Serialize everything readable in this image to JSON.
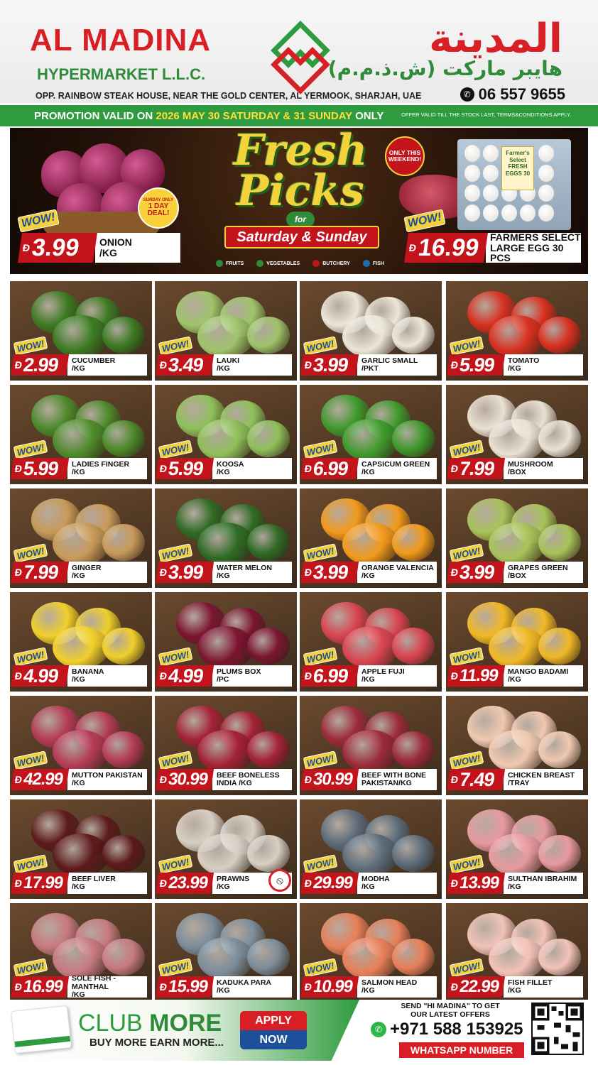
{
  "header": {
    "brand_en": "AL MADINA",
    "brand_sub": "HYPERMARKET L.L.C.",
    "brand_ar": "المدينة",
    "brand_ar_sub": "هايبر ماركت (ش.ذ.م.م)",
    "address": "OPP. RAINBOW STEAK HOUSE, NEAR THE GOLD CENTER, AL YERMOOK, SHARJAH, UAE",
    "phone": "06 557 9655"
  },
  "promo": {
    "prefix": "PROMOTION VALID ON ",
    "dates": "2026 MAY 30 SATURDAY & 31 SUNDAY",
    "suffix": " ONLY",
    "note": "OFFER VALID TILL THE STOCK LAST, TERMS&CONDITIONS APPLY."
  },
  "hero": {
    "title_line1": "Fresh",
    "title_line2": "Picks",
    "for_label": "for",
    "ribbon": "Saturday & Sunday",
    "only_badge": "ONLY THIS WEEKEND!",
    "deal_badge_top": "SUNDAY ONLY",
    "deal_badge_main": "1 DAY DEAL!",
    "egg_label": "Farmer's Select FRESH EGGS 30",
    "categories": [
      "FRUITS",
      "VEGETABLES",
      "BUTCHERY",
      "FISH"
    ],
    "deals": [
      {
        "wow": "WOW!",
        "currency": "Đ",
        "price": "3.99",
        "name": "ONION",
        "unit": "/KG"
      },
      {
        "wow": "WOW!",
        "currency": "Đ",
        "price": "16.99",
        "name": "FARMERS SELECT",
        "unit": "LARGE EGG 30 PCS"
      }
    ]
  },
  "products": [
    {
      "wow": "WOW!",
      "price": "2.99",
      "name": "CUCUMBER",
      "unit": "/KG",
      "color": "#3c7a22"
    },
    {
      "wow": "WOW!",
      "price": "3.49",
      "name": "LAUKI",
      "unit": "/KG",
      "color": "#9fc46a"
    },
    {
      "wow": "WOW!",
      "price": "3.99",
      "name": "GARLIC SMALL",
      "unit": "/PKT",
      "color": "#ece6d8"
    },
    {
      "wow": "WOW!",
      "price": "5.99",
      "name": "TOMATO",
      "unit": "/KG",
      "color": "#d8301f"
    },
    {
      "wow": "WOW!",
      "price": "5.99",
      "name": "LADIES FINGER",
      "unit": "/KG",
      "color": "#4d8a2a"
    },
    {
      "wow": "WOW!",
      "price": "5.99",
      "name": "KOOSA",
      "unit": "/KG",
      "color": "#8fbf5a"
    },
    {
      "wow": "WOW!",
      "price": "6.99",
      "name": "CAPSICUM GREEN",
      "unit": "/KG",
      "color": "#3f9a2c"
    },
    {
      "wow": "WOW!",
      "price": "7.99",
      "name": "MUSHROOM",
      "unit": "/BOX",
      "color": "#e9e1d2"
    },
    {
      "wow": "WOW!",
      "price": "7.99",
      "name": "GINGER",
      "unit": "/KG",
      "color": "#c89a5a"
    },
    {
      "wow": "WOW!",
      "price": "3.99",
      "name": "WATER MELON",
      "unit": "/KG",
      "color": "#2f6b25"
    },
    {
      "wow": "WOW!",
      "price": "3.99",
      "name": "ORANGE VALENCIA",
      "unit": "/KG",
      "color": "#f29a1c"
    },
    {
      "wow": "WOW!",
      "price": "3.99",
      "name": "GRAPES GREEN",
      "unit": "/BOX",
      "color": "#a8c25a"
    },
    {
      "wow": "WOW!",
      "price": "4.99",
      "name": "BANANA",
      "unit": "/KG",
      "color": "#f1cf2a"
    },
    {
      "wow": "WOW!",
      "price": "4.99",
      "name": "PLUMS BOX",
      "unit": "/PC",
      "color": "#7b1530"
    },
    {
      "wow": "WOW!",
      "price": "6.99",
      "name": "APPLE FUJI",
      "unit": "/KG",
      "color": "#d84450"
    },
    {
      "wow": "WOW!",
      "price": "11.99",
      "name": "MANGO BADAMI",
      "unit": "/KG",
      "color": "#f1b825"
    },
    {
      "wow": "WOW!",
      "price": "42.99",
      "name": "MUTTON PAKISTAN",
      "unit": "/KG",
      "color": "#b43b56"
    },
    {
      "wow": "WOW!",
      "price": "30.99",
      "name": "BEEF BONELESS",
      "unit": "INDIA /KG",
      "color": "#a42235"
    },
    {
      "wow": "WOW!",
      "price": "30.99",
      "name": "BEEF WITH BONE",
      "unit": "PAKISTAN/KG",
      "color": "#9c2b3a"
    },
    {
      "wow": "WOW!",
      "price": "7.49",
      "name": "CHICKEN BREAST",
      "unit": "/TRAY",
      "color": "#f0c8b0"
    },
    {
      "wow": "WOW!",
      "price": "17.99",
      "name": "BEEF LIVER",
      "unit": "/KG",
      "color": "#5c1a1a"
    },
    {
      "wow": "WOW!",
      "price": "23.99",
      "name": "PRAWNS",
      "unit": "/KG",
      "color": "#d8cfc4"
    },
    {
      "wow": "WOW!",
      "price": "29.99",
      "name": "MODHA",
      "unit": "/KG",
      "color": "#5d6c7a"
    },
    {
      "wow": "WOW!",
      "price": "13.99",
      "name": "SULTHAN IBRAHIM",
      "unit": "/KG",
      "color": "#e79aa0"
    },
    {
      "wow": "WOW!",
      "price": "16.99",
      "name": "SOLE FISH - MANTHAL",
      "unit": "/KG",
      "color": "#c77a80"
    },
    {
      "wow": "WOW!",
      "price": "15.99",
      "name": "KADUKA PARA",
      "unit": "/KG",
      "color": "#7d8d9a"
    },
    {
      "wow": "WOW!",
      "price": "10.99",
      "name": "SALMON HEAD",
      "unit": "/KG",
      "color": "#e7805a"
    },
    {
      "wow": "WOW!",
      "price": "22.99",
      "name": "FISH FILLET",
      "unit": "/KG",
      "color": "#f2c3b8"
    }
  ],
  "currency": "Đ",
  "footer": {
    "club": "CLUB ",
    "more": "MORE",
    "tagline": "BUY MORE EARN MORE...",
    "apply_top": "APPLY",
    "apply_bottom": "NOW",
    "send_text": "SEND \"HI MADINA\" TO GET OUR LATEST OFFERS",
    "whatsapp_number": "+971 588 153925",
    "whatsapp_label": "WHATSAPP NUMBER"
  },
  "colors": {
    "brand_red": "#d81f26",
    "brand_green": "#2f9b3f",
    "wow_yellow": "#f2d13a"
  }
}
